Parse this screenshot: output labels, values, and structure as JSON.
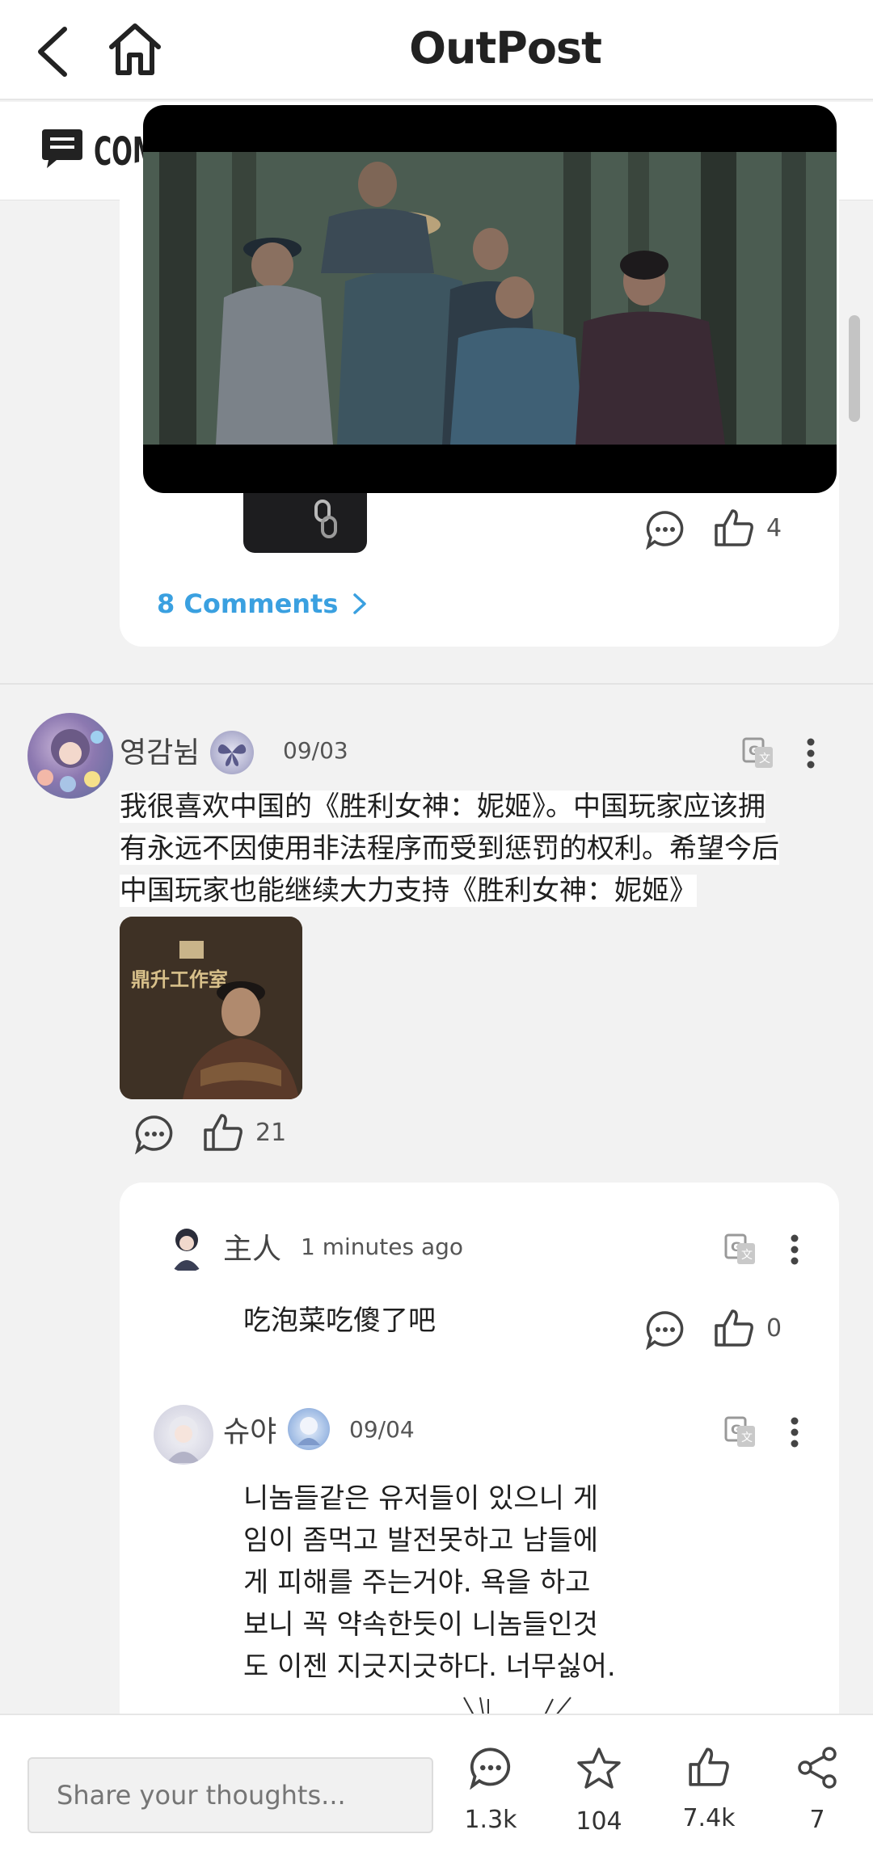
{
  "header": {
    "title": "OutPost"
  },
  "subbar": {
    "label": "COMM"
  },
  "first_post": {
    "like_count": "4",
    "comments_link": "8 Comments"
  },
  "post": {
    "username": "영감뉨",
    "date": "09/03",
    "text_lines": [
      "我很喜欢中国的《胜利女神：妮姬》。中国玩家应该拥",
      "有永远不因使用非法程序而受到惩罚的权利。希望今后",
      "中国玩家也能继续大力支持《胜利女神：妮姬》"
    ],
    "image_caption": "鼎升工作室",
    "like_count": "21"
  },
  "replies": [
    {
      "username": "主人",
      "time": "1 minutes ago",
      "text": "吃泡菜吃傻了吧",
      "like_count": "0"
    },
    {
      "username": "슈야",
      "time": "09/04",
      "text_lines": [
        "니놈들같은 유저들이 있으니 게",
        "임이 좀먹고 발전못하고 남들에",
        "게 피해를 주는거야. 욕을 하고",
        "보니 꼭 약속한듯이 니놈들인것",
        "도 이젠 지긋지긋하다. 너무싫어."
      ]
    }
  ],
  "bottom_bar": {
    "placeholder": "Share your thoughts...",
    "comments": "1.3k",
    "favorites": "104",
    "likes": "7.4k",
    "shares": "7"
  },
  "colors": {
    "accent": "#3aa0e0",
    "background": "#f2f2f2"
  }
}
